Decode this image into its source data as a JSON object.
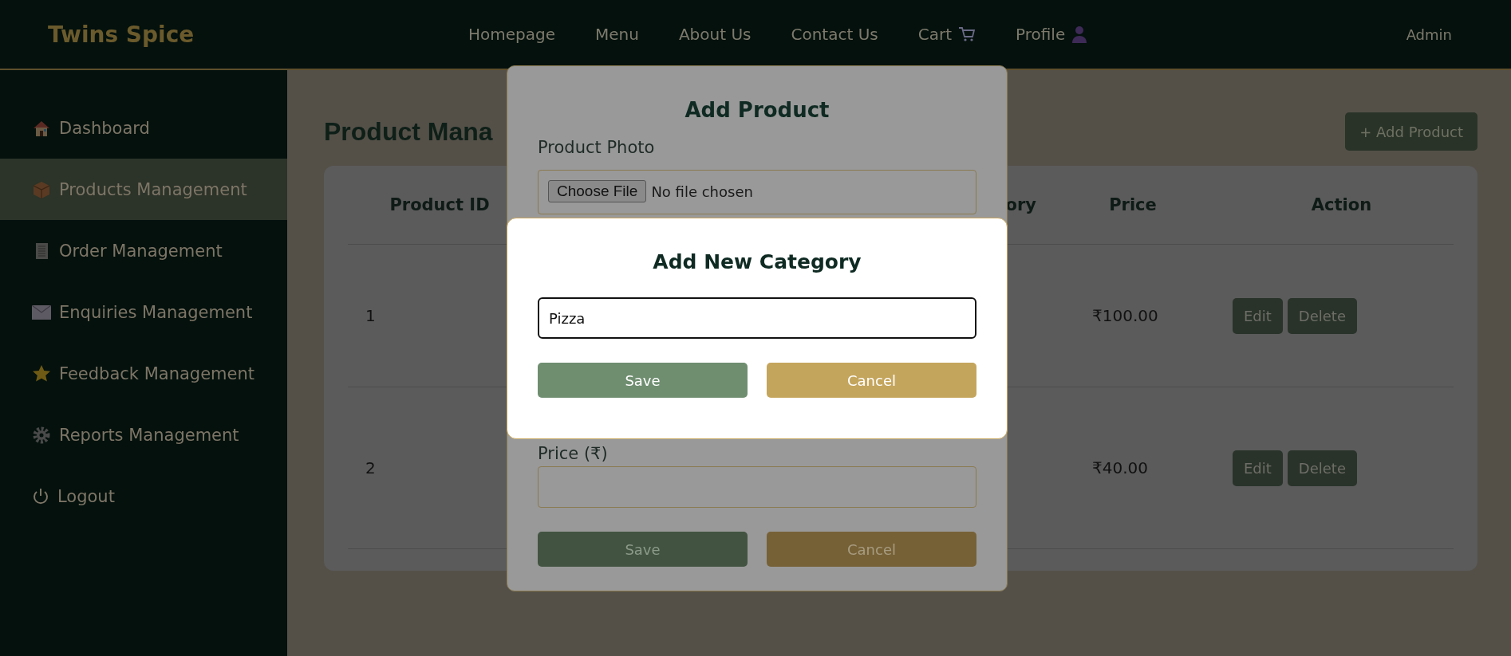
{
  "navbar": {
    "brand": "Twins Spice",
    "links": [
      {
        "label": "Homepage",
        "kind": "text"
      },
      {
        "label": "Menu",
        "kind": "text"
      },
      {
        "label": "About Us",
        "kind": "text"
      },
      {
        "label": "Contact Us",
        "kind": "text"
      },
      {
        "label": "Cart",
        "kind": "cart"
      },
      {
        "label": "Profile",
        "kind": "profile"
      }
    ],
    "user": "Admin"
  },
  "sidebar": {
    "items": [
      {
        "label": "Dashboard",
        "selected": false
      },
      {
        "label": "Products Management",
        "selected": true
      },
      {
        "label": "Order Management",
        "selected": false
      },
      {
        "label": "Enquiries Management",
        "selected": false
      },
      {
        "label": "Feedback Management",
        "selected": false
      },
      {
        "label": "Reports Management",
        "selected": false
      },
      {
        "label": "Logout",
        "selected": false
      }
    ]
  },
  "page": {
    "title": "Product Mana",
    "add_button": "+ Add Product"
  },
  "table": {
    "columns": [
      "Product ID",
      "ory",
      "Price",
      "Action"
    ],
    "rows": [
      {
        "product_id": "1",
        "price": "₹100.00",
        "actions": [
          "Edit",
          "Delete"
        ]
      },
      {
        "product_id": "2",
        "price": "₹40.00",
        "actions": [
          "Edit",
          "Delete"
        ]
      }
    ]
  },
  "add_product_dialog": {
    "title": "Add Product",
    "photo_label": "Product Photo",
    "file_button": "Choose File",
    "file_status": "No file chosen",
    "price_label": "Price (₹)",
    "buttons": [
      {
        "label": "Save",
        "kind": "primary"
      },
      {
        "label": "Cancel",
        "kind": "secondary"
      }
    ]
  },
  "category_dialog": {
    "title": "Add New Category",
    "value": "Pizza",
    "buttons": [
      {
        "label": "Save",
        "kind": "primary"
      },
      {
        "label": "Cancel",
        "kind": "secondary"
      }
    ]
  }
}
